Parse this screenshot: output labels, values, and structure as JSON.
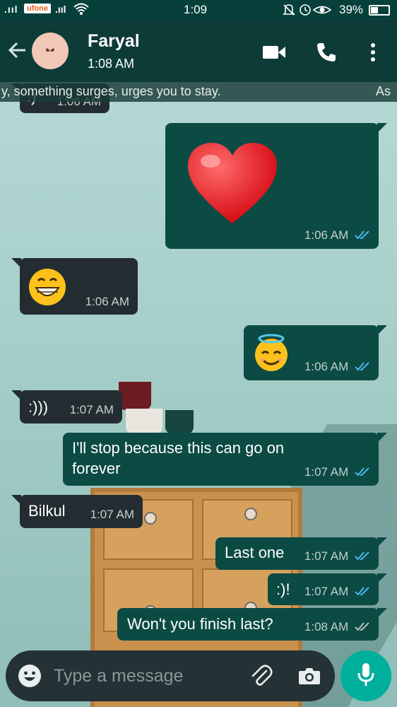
{
  "status_bar": {
    "carrier": "ufone",
    "time": "1:09",
    "battery": "39%"
  },
  "header": {
    "contact_name": "Faryal",
    "last_seen": "1:08 AM",
    "icons": [
      "back-arrow-icon",
      "video-call-icon",
      "voice-call-icon",
      "more-options-icon"
    ]
  },
  "marquee": {
    "text": "y, something surges, urges you to stay.",
    "trailing": "As"
  },
  "partial_message": {
    "text": ":)",
    "time": "1:06 AM"
  },
  "messages": [
    {
      "dir": "out",
      "emoji": "❤️",
      "time": "1:06 AM",
      "status": "read"
    },
    {
      "dir": "in",
      "emoji": "😁",
      "time": "1:06 AM"
    },
    {
      "dir": "out",
      "emoji": "😇",
      "time": "1:06 AM",
      "status": "read"
    },
    {
      "dir": "in",
      "text": ":)))",
      "time": "1:07 AM"
    },
    {
      "dir": "out",
      "text": "I'll stop because this can go on forever",
      "time": "1:07 AM",
      "status": "read"
    },
    {
      "dir": "in",
      "text": "Bilkul",
      "time": "1:07 AM"
    },
    {
      "dir": "out",
      "text": "Last one",
      "time": "1:07 AM",
      "status": "read"
    },
    {
      "dir": "out",
      "text": ":)!",
      "time": "1:07 AM",
      "status": "read"
    },
    {
      "dir": "out",
      "text": "Won't you finish last?",
      "time": "1:08 AM",
      "status": "delivered"
    }
  ],
  "input": {
    "placeholder": "Type a message"
  },
  "colors": {
    "header": "#0d3b37",
    "outgoing_bubble": "#0b4b44",
    "incoming_bubble": "#232d31",
    "read_tick": "#4fb6ec",
    "mic_button": "#00af9c"
  }
}
